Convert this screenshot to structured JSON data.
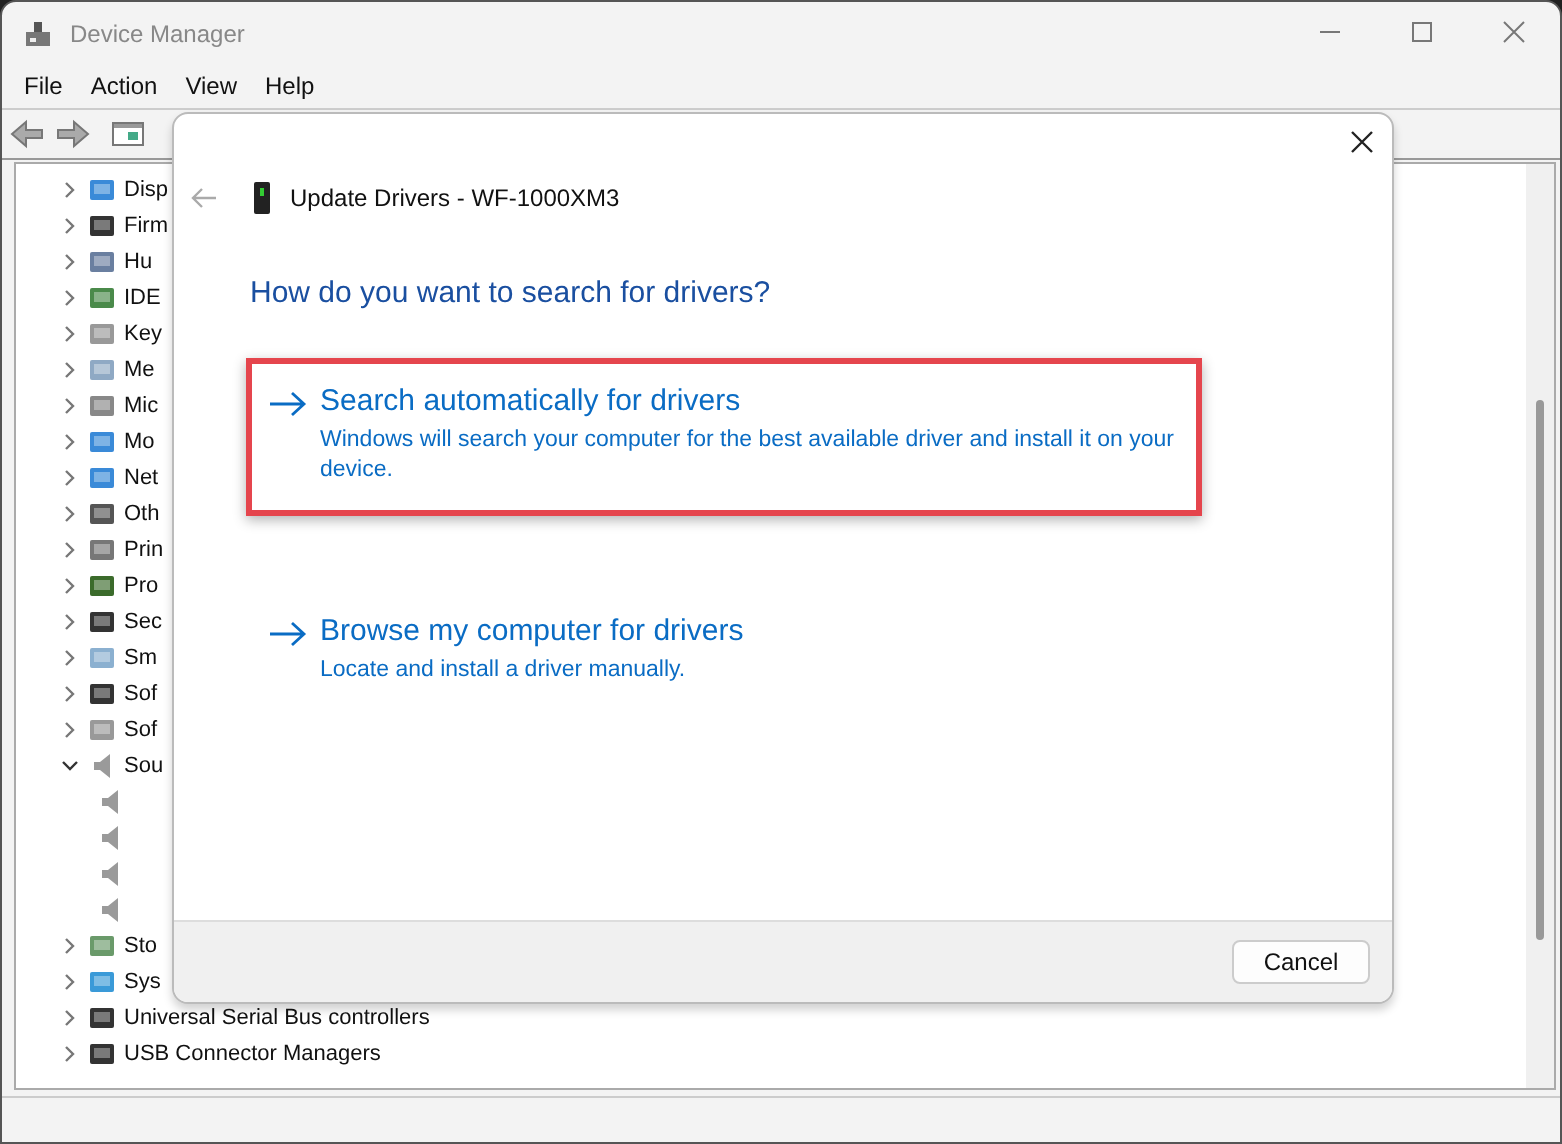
{
  "window": {
    "title": "Device Manager"
  },
  "menu": [
    "File",
    "Action",
    "View",
    "Help"
  ],
  "tree": [
    {
      "label": "Disp",
      "expanded": false
    },
    {
      "label": "Firm",
      "expanded": false
    },
    {
      "label": "Hu",
      "expanded": false
    },
    {
      "label": "IDE",
      "expanded": false
    },
    {
      "label": "Key",
      "expanded": false
    },
    {
      "label": "Me",
      "expanded": false
    },
    {
      "label": "Mic",
      "expanded": false
    },
    {
      "label": "Mo",
      "expanded": false
    },
    {
      "label": "Net",
      "expanded": false
    },
    {
      "label": "Oth",
      "expanded": false
    },
    {
      "label": "Prin",
      "expanded": false
    },
    {
      "label": "Pro",
      "expanded": false
    },
    {
      "label": "Sec",
      "expanded": false
    },
    {
      "label": "Sm",
      "expanded": false
    },
    {
      "label": "Sof",
      "expanded": false
    },
    {
      "label": "Sof",
      "expanded": false
    },
    {
      "label": "Sou",
      "expanded": true,
      "children": [
        {
          "kind": "speaker"
        },
        {
          "kind": "speaker"
        },
        {
          "kind": "speaker"
        },
        {
          "kind": "speaker"
        }
      ]
    },
    {
      "label": "Sto",
      "expanded": false
    },
    {
      "label": "Sys",
      "expanded": false
    },
    {
      "label": "Universal Serial Bus controllers",
      "expanded": false
    },
    {
      "label": "USB Connector Managers",
      "expanded": false
    }
  ],
  "dialog": {
    "title": "Update Drivers - WF-1000XM3",
    "heading": "How do you want to search for drivers?",
    "options": [
      {
        "title": "Search automatically for drivers",
        "description": "Windows will search your computer for the best available driver and install it on your device.",
        "highlighted": true
      },
      {
        "title": "Browse my computer for drivers",
        "description": "Locate and install a driver manually.",
        "highlighted": false
      }
    ],
    "buttons": [
      "Cancel"
    ]
  }
}
